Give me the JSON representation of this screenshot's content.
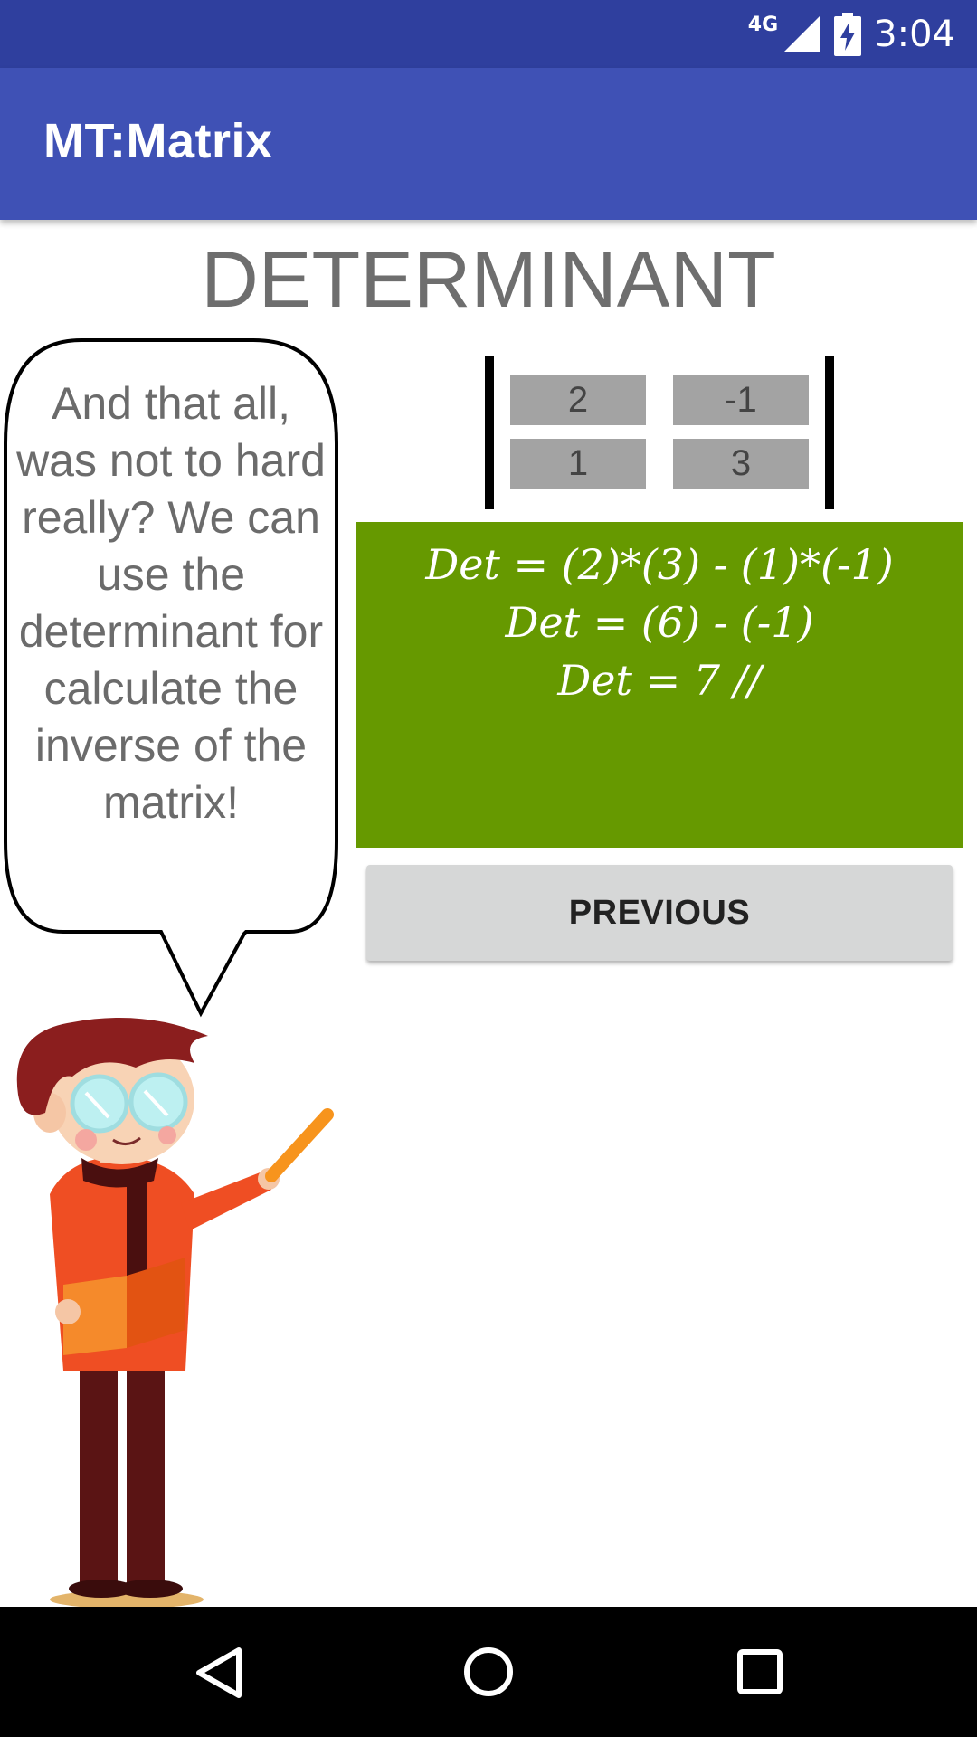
{
  "status_bar": {
    "network": "4G",
    "time": "3:04",
    "icons": [
      "signal-icon",
      "battery-charging-icon"
    ]
  },
  "app_bar": {
    "title": "MT:Matrix"
  },
  "page": {
    "title": "DETERMINANT"
  },
  "speech": {
    "text": "And that all, was not to hard really? We can use the determinant for calculate the inverse of the matrix!"
  },
  "matrix": {
    "rows": [
      [
        "2",
        "-1"
      ],
      [
        "1",
        "3"
      ]
    ]
  },
  "result": {
    "lines": [
      "Det = (2)*(3) - (1)*(-1)",
      "Det = (6) - (-1)",
      "Det = 7 //"
    ],
    "background": "#669900"
  },
  "buttons": {
    "previous": "PREVIOUS"
  },
  "nav_bar": {
    "icons": [
      "back-icon",
      "home-icon",
      "recents-icon"
    ]
  },
  "colors": {
    "status_bar": "#2f3f9e",
    "app_bar": "#3f51b5",
    "title_text": "#6e6e6e"
  }
}
